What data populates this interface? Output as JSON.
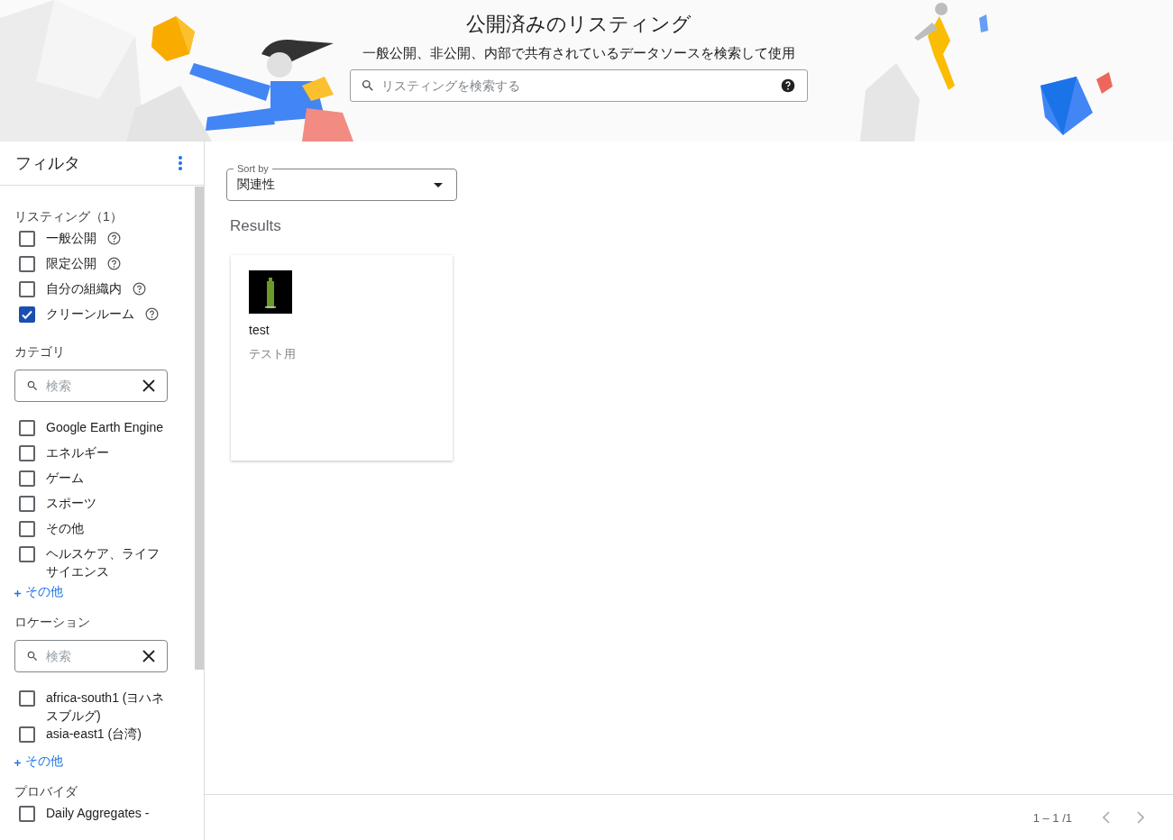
{
  "header": {
    "title": "公開済みのリスティング",
    "subtitle": "一般公開、非公開、内部で共有されているデータソースを検索して使用",
    "search": {
      "placeholder": "リスティングを検索する"
    }
  },
  "filter": {
    "title": "フィルタ",
    "sections": [
      {
        "title": "リスティング（1）",
        "items": [
          {
            "label": "一般公開",
            "checked": false,
            "help": true
          },
          {
            "label": "限定公開",
            "checked": false,
            "help": true
          },
          {
            "label": "自分の組織内",
            "checked": false,
            "help": true
          },
          {
            "label": "クリーンルーム",
            "checked": true,
            "help": true
          }
        ]
      },
      {
        "title": "カテゴリ",
        "search": {
          "placeholder": "検索"
        },
        "items": [
          {
            "label": "Google Earth Engine",
            "checked": false
          },
          {
            "label": "エネルギー",
            "checked": false
          },
          {
            "label": "ゲーム",
            "checked": false
          },
          {
            "label": "スポーツ",
            "checked": false
          },
          {
            "label": "その他",
            "checked": false
          },
          {
            "label": "ヘルスケア、ライフサイエンス",
            "checked": false
          }
        ],
        "more": "その他"
      },
      {
        "title": "ロケーション",
        "search": {
          "placeholder": "検索"
        },
        "items": [
          {
            "label": "africa-south1 (ヨハネスブルグ)",
            "checked": false
          },
          {
            "label": "asia-east1 (台湾)",
            "checked": false
          }
        ],
        "more": "その他"
      },
      {
        "title": "プロバイダ",
        "items": [
          {
            "label": "Daily Aggregates -",
            "checked": false
          }
        ]
      }
    ]
  },
  "sort": {
    "label": "Sort by",
    "value": "関連性"
  },
  "results": {
    "heading": "Results",
    "cards": [
      {
        "title": "test",
        "description": "テスト用"
      }
    ]
  },
  "pagination": {
    "range": "1 – 1 /1"
  }
}
